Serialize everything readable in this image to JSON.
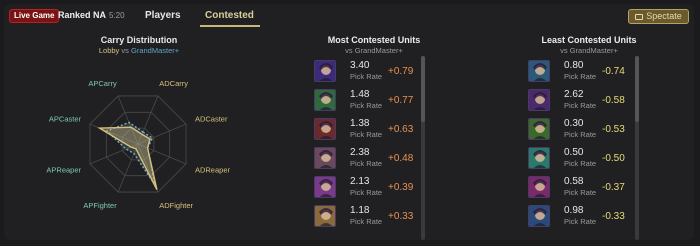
{
  "header": {
    "live_badge": "Live Game",
    "queue": "Ranked NA",
    "timer": "5:20",
    "tabs": [
      {
        "label": "Players",
        "active": false
      },
      {
        "label": "Contested",
        "active": true
      }
    ],
    "spectate_label": "Spectate",
    "accent_color": "#c9b776"
  },
  "carry": {
    "title": "Carry Distribution",
    "sub_lobby": "Lobby",
    "sub_vs": "vs",
    "sub_gm": "GrandMaster+",
    "axes": [
      "ADCarry",
      "ADCaster",
      "ADReaper",
      "ADFighter",
      "APFighter",
      "APReaper",
      "APCaster",
      "APCarry"
    ],
    "lobby_values": [
      0.2,
      0.25,
      0.2,
      0.95,
      0.1,
      0.15,
      0.8,
      0.35
    ],
    "gm_values": [
      0.25,
      0.3,
      0.2,
      0.85,
      0.2,
      0.25,
      0.65,
      0.45
    ],
    "lobby_color": "#d6c17c",
    "gm_color": "#7fb0c8"
  },
  "most": {
    "title": "Most Contested Units",
    "sub": "vs GrandMaster+",
    "rate_label": "Pick Rate",
    "units": [
      {
        "icon": "champion-portrait-icon",
        "rate": "3.40",
        "delta": "+0.79"
      },
      {
        "icon": "champion-portrait-icon",
        "rate": "1.48",
        "delta": "+0.77"
      },
      {
        "icon": "champion-portrait-icon",
        "rate": "1.38",
        "delta": "+0.63"
      },
      {
        "icon": "champion-portrait-icon",
        "rate": "2.38",
        "delta": "+0.48"
      },
      {
        "icon": "champion-portrait-icon",
        "rate": "2.13",
        "delta": "+0.39"
      },
      {
        "icon": "champion-portrait-icon",
        "rate": "1.18",
        "delta": "+0.33"
      }
    ]
  },
  "least": {
    "title": "Least Contested Units",
    "sub": "vs GrandMaster+",
    "rate_label": "Pick Rate",
    "units": [
      {
        "icon": "champion-portrait-icon",
        "rate": "0.80",
        "delta": "-0.74"
      },
      {
        "icon": "champion-portrait-icon",
        "rate": "2.62",
        "delta": "-0.58"
      },
      {
        "icon": "champion-portrait-icon",
        "rate": "0.30",
        "delta": "-0.53"
      },
      {
        "icon": "champion-portrait-icon",
        "rate": "0.50",
        "delta": "-0.50"
      },
      {
        "icon": "champion-portrait-icon",
        "rate": "0.58",
        "delta": "-0.37"
      },
      {
        "icon": "champion-portrait-icon",
        "rate": "0.98",
        "delta": "-0.33"
      }
    ]
  },
  "portrait_colors": {
    "most": [
      "#3c2a7a",
      "#2e6a3c",
      "#6a2a2a",
      "#6a4a5a",
      "#7a3a8a",
      "#8a6a3a"
    ],
    "least": [
      "#2a5a7a",
      "#4a2a6a",
      "#3a6a2a",
      "#2a7a6a",
      "#7a2a6a",
      "#2a4a7a"
    ]
  }
}
